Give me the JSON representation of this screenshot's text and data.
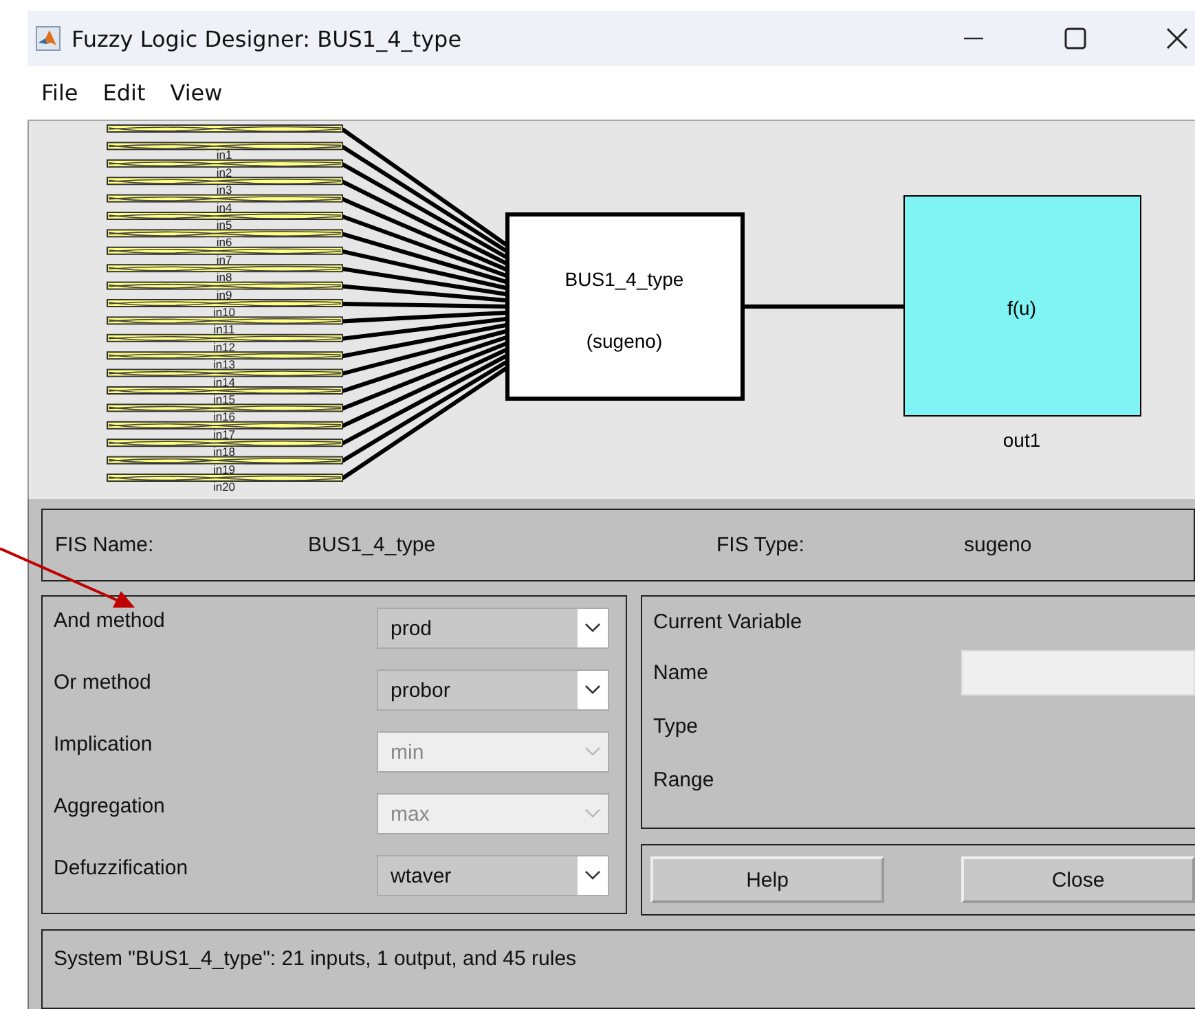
{
  "window": {
    "title": "Fuzzy Logic Designer: BUS1_4_type"
  },
  "menu": [
    "File",
    "Edit",
    "View"
  ],
  "diagram": {
    "inputs": [
      "in1",
      "in2",
      "in3",
      "in4",
      "in5",
      "in6",
      "in7",
      "in8",
      "in9",
      "in10",
      "in11",
      "in12",
      "in13",
      "in14",
      "in15",
      "in16",
      "in17",
      "in18",
      "in19",
      "in20"
    ],
    "system": {
      "name": "BUS1_4_type",
      "type": "(sugeno)"
    },
    "output": {
      "function": "f(u)",
      "label": "out1"
    }
  },
  "fis": {
    "name_label": "FIS Name:",
    "name": "BUS1_4_type",
    "type_label": "FIS Type:",
    "type": "sugeno"
  },
  "methods": [
    {
      "label": "And method",
      "value": "prod",
      "disabled": false
    },
    {
      "label": "Or method",
      "value": "probor",
      "disabled": false
    },
    {
      "label": "Implication",
      "value": "min",
      "disabled": true
    },
    {
      "label": "Aggregation",
      "value": "max",
      "disabled": true
    },
    {
      "label": "Defuzzification",
      "value": "wtaver",
      "disabled": false
    }
  ],
  "current_variable": {
    "title": "Current Variable",
    "fields": [
      "Name",
      "Type",
      "Range"
    ]
  },
  "buttons": [
    "Help",
    "Close"
  ],
  "status": "System \"BUS1_4_type\": 21 inputs, 1 output, and 45 rules"
}
